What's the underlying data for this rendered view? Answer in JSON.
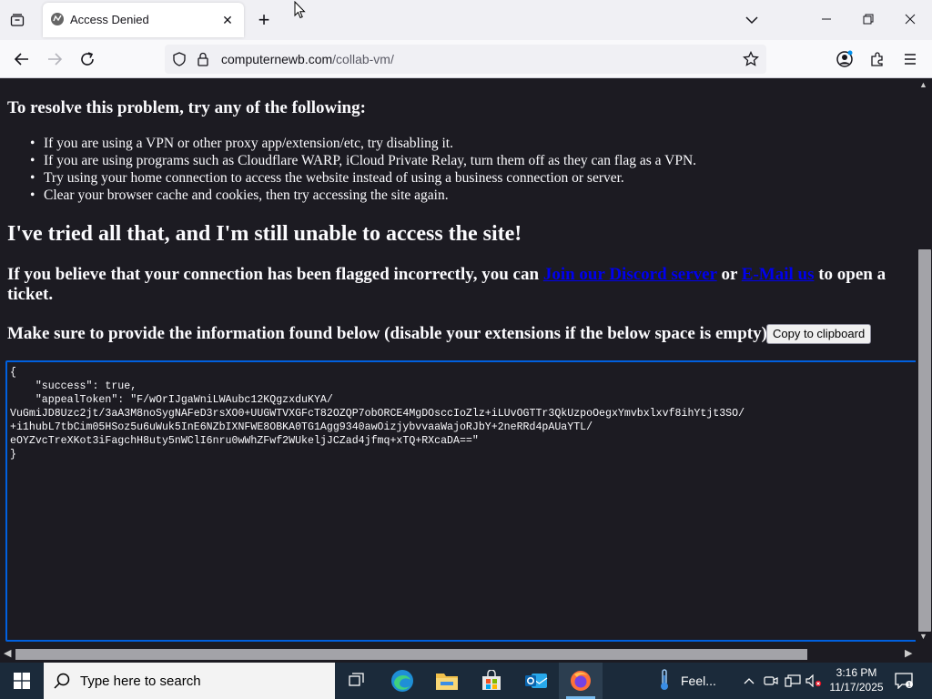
{
  "browser": {
    "tab": {
      "title": "Access Denied"
    },
    "address": {
      "domain": "computernewb.com",
      "path": "/collab-vm/"
    }
  },
  "page": {
    "resolve_heading": "To resolve this problem, try any of the following:",
    "tips": [
      "If you are using a VPN or other proxy app/extension/etc, try disabling it.",
      "If you are using programs such as Cloudflare WARP, iCloud Private Relay, turn them off as they can flag as a VPN.",
      "Try using your home connection to access the website instead of using a business connection or server.",
      "Clear your browser cache and cookies, then try accessing the site again."
    ],
    "tried_heading": "I've tried all that, and I'm still unable to access the site!",
    "flagged_text_1": "If you believe that your connection has been flagged incorrectly, you can ",
    "discord_link": "Join our Discord server",
    "or_text": " or ",
    "email_link": "E-Mail us",
    "flagged_text_2": " to open a ticket.",
    "provide_text": "Make sure to provide the information found below (disable your extensions if the below space is empty):",
    "copy_button": "Copy to clipboard",
    "code_lines": [
      "{",
      "    \"success\": true,",
      "    \"appealToken\": \"F/wOrIJgaWniLWAubc12KQgzxduKYA/",
      "VuGmiJD8Uzc2jt/3aA3M8noSygNAFeD3rsXO0+UUGWTVXGFcT82OZQP7obORCE4MgDOsccIoZlz+iLUvOGTTr3QkUzpoOegxYmvbxlxvf8ihYtjt3SO/",
      "+i1hubL7tbCim05HSoz5u6uWuk5InE6NZbIXNFWE8OBKA0TG1Agg9340awOizjybvvaaWajoRJbY+2neRRd4pAUaYTL/",
      "eOYZvcTreXKot3iFagchH8uty5nWClI6nru0wWhZFwf2WUkeljJCZad4jfmq+xTQ+RXcaDA==\"",
      "}"
    ]
  },
  "taskbar": {
    "search_placeholder": "Type here to search",
    "weather_text": "Feel...",
    "time": "3:16 PM",
    "date": "11/17/2025"
  },
  "colors": {
    "page_bg": "#1c1b22",
    "link": "#0000ee",
    "focus_border": "#0060df",
    "taskbar_bg": "#1b2a3a"
  }
}
